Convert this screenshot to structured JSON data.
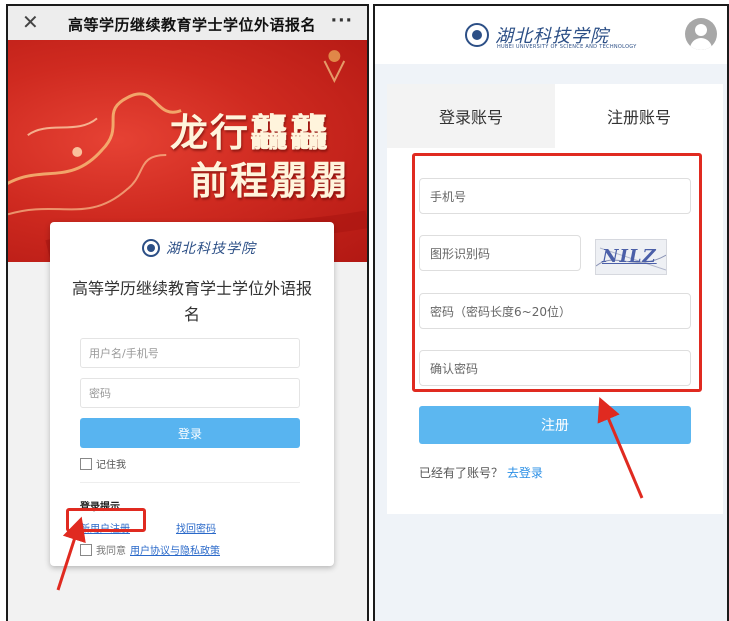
{
  "left": {
    "titlebar": {
      "close_glyph": "✕",
      "title": "高等学历继续教育学士学位外语报名",
      "more_glyph": "···"
    },
    "banner": {
      "slogan_line1": "龙行龘龘",
      "slogan_line2": "前程朤朤"
    },
    "card": {
      "logo_text": "湖北科技学院",
      "title": "高等学历继续教育学士学位外语报名",
      "username_placeholder": "用户名/手机号",
      "password_placeholder": "密码",
      "login_button": "登录",
      "remember_label": "记住我",
      "hint_title": "登录提示",
      "register_link": "新用户注册",
      "forgot_link": "找回密码",
      "agree_prefix": "我同意",
      "agree_policy": "用户协议与隐私政策"
    }
  },
  "right": {
    "header": {
      "logo_text": "湖北科技学院",
      "logo_subtitle": "HUBEI UNIVERSITY OF SCIENCE AND TECHNOLOGY"
    },
    "tabs": {
      "login": "登录账号",
      "register": "注册账号"
    },
    "form": {
      "phone_placeholder": "手机号",
      "captcha_placeholder": "图形识别码",
      "captcha_code": "NILZ",
      "password_placeholder": "密码（密码长度6~20位）",
      "confirm_placeholder": "确认密码",
      "register_button": "注册",
      "has_account_text": "已经有了账号？",
      "go_login_link": "去登录"
    }
  },
  "colors": {
    "highlight_red": "#e02a20",
    "button_blue": "#5cb7f0",
    "link_blue": "#2a69c9",
    "banner_red": "#cf2a20"
  },
  "icons": [
    "close-icon",
    "more-icon",
    "seal-logo-icon",
    "avatar-icon",
    "checkbox-icon",
    "annotation-arrow-icon"
  ]
}
